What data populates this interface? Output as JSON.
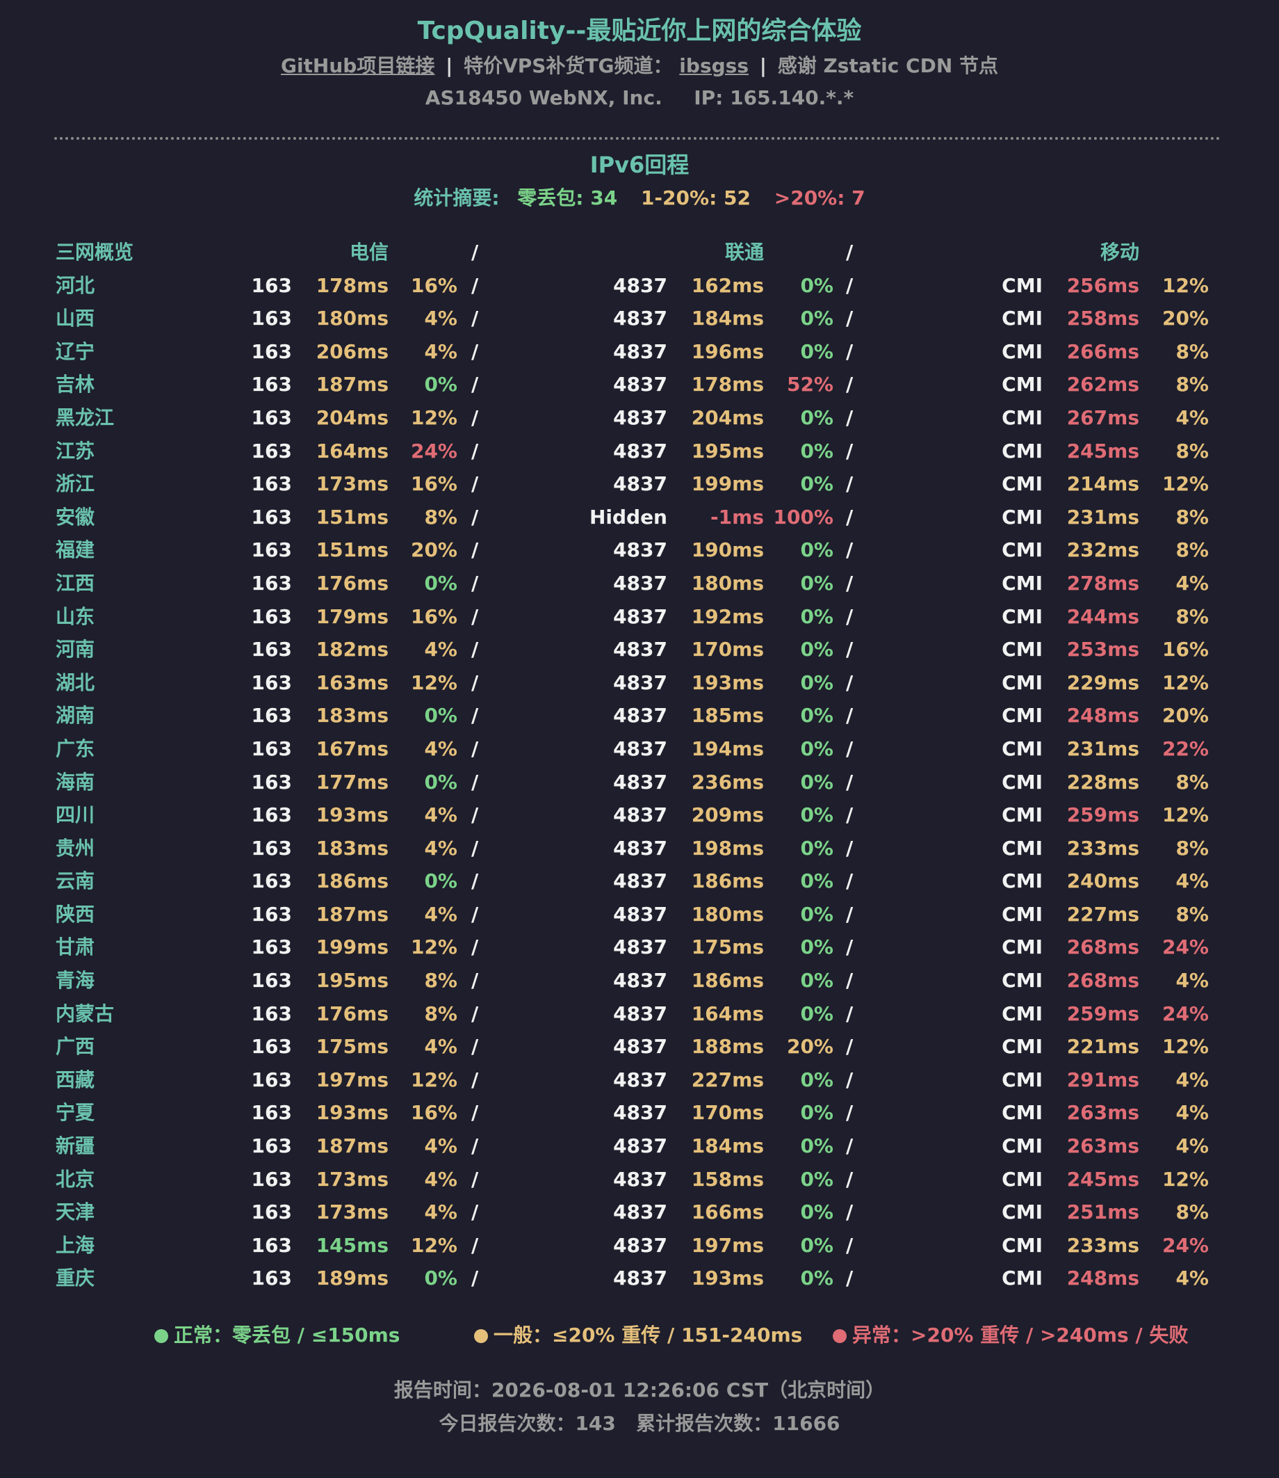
{
  "header": {
    "title": "TcpQuality--最贴近你上网的综合体验",
    "github_link": "GitHub项目链接",
    "separator": "|",
    "vps_text": "特价VPS补货TG频道：",
    "tg_link": "ibsgss",
    "cdn_text": "感谢 Zstatic CDN 节点",
    "asn": "AS18450 WebNX, Inc.",
    "ip": "IP: 165.140.*.*"
  },
  "section": {
    "title": "IPv6回程",
    "summary_label": "统计摘要:",
    "zero_loss": "零丢包: 34",
    "range_1_20": "1-20%: 52",
    "over_20": ">20%: 7"
  },
  "table": {
    "header": {
      "overview": "三网概览",
      "telecom": "电信",
      "unicom": "联通",
      "mobile": "移动",
      "slash": "/"
    },
    "rows": [
      {
        "province": "河北",
        "ct_asn": "163",
        "ct_lat": "178ms",
        "ct_loss": "16%",
        "cu_asn": "4837",
        "cu_lat": "162ms",
        "cu_loss": "0%",
        "cm_asn": "CMI",
        "cm_lat": "256ms",
        "cm_loss": "12%"
      },
      {
        "province": "山西",
        "ct_asn": "163",
        "ct_lat": "180ms",
        "ct_loss": "4%",
        "cu_asn": "4837",
        "cu_lat": "184ms",
        "cu_loss": "0%",
        "cm_asn": "CMI",
        "cm_lat": "258ms",
        "cm_loss": "20%"
      },
      {
        "province": "辽宁",
        "ct_asn": "163",
        "ct_lat": "206ms",
        "ct_loss": "4%",
        "cu_asn": "4837",
        "cu_lat": "196ms",
        "cu_loss": "0%",
        "cm_asn": "CMI",
        "cm_lat": "266ms",
        "cm_loss": "8%"
      },
      {
        "province": "吉林",
        "ct_asn": "163",
        "ct_lat": "187ms",
        "ct_loss": "0%",
        "cu_asn": "4837",
        "cu_lat": "178ms",
        "cu_loss": "52%",
        "cm_asn": "CMI",
        "cm_lat": "262ms",
        "cm_loss": "8%"
      },
      {
        "province": "黑龙江",
        "ct_asn": "163",
        "ct_lat": "204ms",
        "ct_loss": "12%",
        "cu_asn": "4837",
        "cu_lat": "204ms",
        "cu_loss": "0%",
        "cm_asn": "CMI",
        "cm_lat": "267ms",
        "cm_loss": "4%"
      },
      {
        "province": "江苏",
        "ct_asn": "163",
        "ct_lat": "164ms",
        "ct_loss": "24%",
        "cu_asn": "4837",
        "cu_lat": "195ms",
        "cu_loss": "0%",
        "cm_asn": "CMI",
        "cm_lat": "245ms",
        "cm_loss": "8%"
      },
      {
        "province": "浙江",
        "ct_asn": "163",
        "ct_lat": "173ms",
        "ct_loss": "16%",
        "cu_asn": "4837",
        "cu_lat": "199ms",
        "cu_loss": "0%",
        "cm_asn": "CMI",
        "cm_lat": "214ms",
        "cm_loss": "12%"
      },
      {
        "province": "安徽",
        "ct_asn": "163",
        "ct_lat": "151ms",
        "ct_loss": "8%",
        "cu_asn": "Hidden",
        "cu_lat": "-1ms",
        "cu_loss": "100%",
        "cm_asn": "CMI",
        "cm_lat": "231ms",
        "cm_loss": "8%"
      },
      {
        "province": "福建",
        "ct_asn": "163",
        "ct_lat": "151ms",
        "ct_loss": "20%",
        "cu_asn": "4837",
        "cu_lat": "190ms",
        "cu_loss": "0%",
        "cm_asn": "CMI",
        "cm_lat": "232ms",
        "cm_loss": "8%"
      },
      {
        "province": "江西",
        "ct_asn": "163",
        "ct_lat": "176ms",
        "ct_loss": "0%",
        "cu_asn": "4837",
        "cu_lat": "180ms",
        "cu_loss": "0%",
        "cm_asn": "CMI",
        "cm_lat": "278ms",
        "cm_loss": "4%"
      },
      {
        "province": "山东",
        "ct_asn": "163",
        "ct_lat": "179ms",
        "ct_loss": "16%",
        "cu_asn": "4837",
        "cu_lat": "192ms",
        "cu_loss": "0%",
        "cm_asn": "CMI",
        "cm_lat": "244ms",
        "cm_loss": "8%"
      },
      {
        "province": "河南",
        "ct_asn": "163",
        "ct_lat": "182ms",
        "ct_loss": "4%",
        "cu_asn": "4837",
        "cu_lat": "170ms",
        "cu_loss": "0%",
        "cm_asn": "CMI",
        "cm_lat": "253ms",
        "cm_loss": "16%"
      },
      {
        "province": "湖北",
        "ct_asn": "163",
        "ct_lat": "163ms",
        "ct_loss": "12%",
        "cu_asn": "4837",
        "cu_lat": "193ms",
        "cu_loss": "0%",
        "cm_asn": "CMI",
        "cm_lat": "229ms",
        "cm_loss": "12%"
      },
      {
        "province": "湖南",
        "ct_asn": "163",
        "ct_lat": "183ms",
        "ct_loss": "0%",
        "cu_asn": "4837",
        "cu_lat": "185ms",
        "cu_loss": "0%",
        "cm_asn": "CMI",
        "cm_lat": "248ms",
        "cm_loss": "20%"
      },
      {
        "province": "广东",
        "ct_asn": "163",
        "ct_lat": "167ms",
        "ct_loss": "4%",
        "cu_asn": "4837",
        "cu_lat": "194ms",
        "cu_loss": "0%",
        "cm_asn": "CMI",
        "cm_lat": "231ms",
        "cm_loss": "22%"
      },
      {
        "province": "海南",
        "ct_asn": "163",
        "ct_lat": "177ms",
        "ct_loss": "0%",
        "cu_asn": "4837",
        "cu_lat": "236ms",
        "cu_loss": "0%",
        "cm_asn": "CMI",
        "cm_lat": "228ms",
        "cm_loss": "8%"
      },
      {
        "province": "四川",
        "ct_asn": "163",
        "ct_lat": "193ms",
        "ct_loss": "4%",
        "cu_asn": "4837",
        "cu_lat": "209ms",
        "cu_loss": "0%",
        "cm_asn": "CMI",
        "cm_lat": "259ms",
        "cm_loss": "12%"
      },
      {
        "province": "贵州",
        "ct_asn": "163",
        "ct_lat": "183ms",
        "ct_loss": "4%",
        "cu_asn": "4837",
        "cu_lat": "198ms",
        "cu_loss": "0%",
        "cm_asn": "CMI",
        "cm_lat": "233ms",
        "cm_loss": "8%"
      },
      {
        "province": "云南",
        "ct_asn": "163",
        "ct_lat": "186ms",
        "ct_loss": "0%",
        "cu_asn": "4837",
        "cu_lat": "186ms",
        "cu_loss": "0%",
        "cm_asn": "CMI",
        "cm_lat": "240ms",
        "cm_loss": "4%"
      },
      {
        "province": "陕西",
        "ct_asn": "163",
        "ct_lat": "187ms",
        "ct_loss": "4%",
        "cu_asn": "4837",
        "cu_lat": "180ms",
        "cu_loss": "0%",
        "cm_asn": "CMI",
        "cm_lat": "227ms",
        "cm_loss": "8%"
      },
      {
        "province": "甘肃",
        "ct_asn": "163",
        "ct_lat": "199ms",
        "ct_loss": "12%",
        "cu_asn": "4837",
        "cu_lat": "175ms",
        "cu_loss": "0%",
        "cm_asn": "CMI",
        "cm_lat": "268ms",
        "cm_loss": "24%"
      },
      {
        "province": "青海",
        "ct_asn": "163",
        "ct_lat": "195ms",
        "ct_loss": "8%",
        "cu_asn": "4837",
        "cu_lat": "186ms",
        "cu_loss": "0%",
        "cm_asn": "CMI",
        "cm_lat": "268ms",
        "cm_loss": "4%"
      },
      {
        "province": "内蒙古",
        "ct_asn": "163",
        "ct_lat": "176ms",
        "ct_loss": "8%",
        "cu_asn": "4837",
        "cu_lat": "164ms",
        "cu_loss": "0%",
        "cm_asn": "CMI",
        "cm_lat": "259ms",
        "cm_loss": "24%"
      },
      {
        "province": "广西",
        "ct_asn": "163",
        "ct_lat": "175ms",
        "ct_loss": "4%",
        "cu_asn": "4837",
        "cu_lat": "188ms",
        "cu_loss": "20%",
        "cm_asn": "CMI",
        "cm_lat": "221ms",
        "cm_loss": "12%"
      },
      {
        "province": "西藏",
        "ct_asn": "163",
        "ct_lat": "197ms",
        "ct_loss": "12%",
        "cu_asn": "4837",
        "cu_lat": "227ms",
        "cu_loss": "0%",
        "cm_asn": "CMI",
        "cm_lat": "291ms",
        "cm_loss": "4%"
      },
      {
        "province": "宁夏",
        "ct_asn": "163",
        "ct_lat": "193ms",
        "ct_loss": "16%",
        "cu_asn": "4837",
        "cu_lat": "170ms",
        "cu_loss": "0%",
        "cm_asn": "CMI",
        "cm_lat": "263ms",
        "cm_loss": "4%"
      },
      {
        "province": "新疆",
        "ct_asn": "163",
        "ct_lat": "187ms",
        "ct_loss": "4%",
        "cu_asn": "4837",
        "cu_lat": "184ms",
        "cu_loss": "0%",
        "cm_asn": "CMI",
        "cm_lat": "263ms",
        "cm_loss": "4%"
      },
      {
        "province": "北京",
        "ct_asn": "163",
        "ct_lat": "173ms",
        "ct_loss": "4%",
        "cu_asn": "4837",
        "cu_lat": "158ms",
        "cu_loss": "0%",
        "cm_asn": "CMI",
        "cm_lat": "245ms",
        "cm_loss": "12%"
      },
      {
        "province": "天津",
        "ct_asn": "163",
        "ct_lat": "173ms",
        "ct_loss": "4%",
        "cu_asn": "4837",
        "cu_lat": "166ms",
        "cu_loss": "0%",
        "cm_asn": "CMI",
        "cm_lat": "251ms",
        "cm_loss": "8%"
      },
      {
        "province": "上海",
        "ct_asn": "163",
        "ct_lat": "145ms",
        "ct_loss": "12%",
        "cu_asn": "4837",
        "cu_lat": "197ms",
        "cu_loss": "0%",
        "cm_asn": "CMI",
        "cm_lat": "233ms",
        "cm_loss": "24%"
      },
      {
        "province": "重庆",
        "ct_asn": "163",
        "ct_lat": "189ms",
        "ct_loss": "0%",
        "cu_asn": "4837",
        "cu_lat": "193ms",
        "cu_loss": "0%",
        "cm_asn": "CMI",
        "cm_lat": "248ms",
        "cm_loss": "4%"
      }
    ]
  },
  "legend": {
    "normal": "正常：零丢包 / ≤150ms",
    "fair": "一般：≤20% 重传 / 151-240ms",
    "abnormal": "异常：>20% 重传 / >240ms / 失败"
  },
  "footer": {
    "report_time": "报告时间：2026-08-01 12:26:06 CST（北京时间）",
    "counts": "今日报告次数：143   累计报告次数：11666"
  },
  "colors": {
    "background": "#1e1e2c",
    "accent": "#6ac2ad",
    "good": "#7bd389",
    "fair": "#e5c07b",
    "bad": "#e06c75",
    "muted": "#9a9a9a"
  }
}
